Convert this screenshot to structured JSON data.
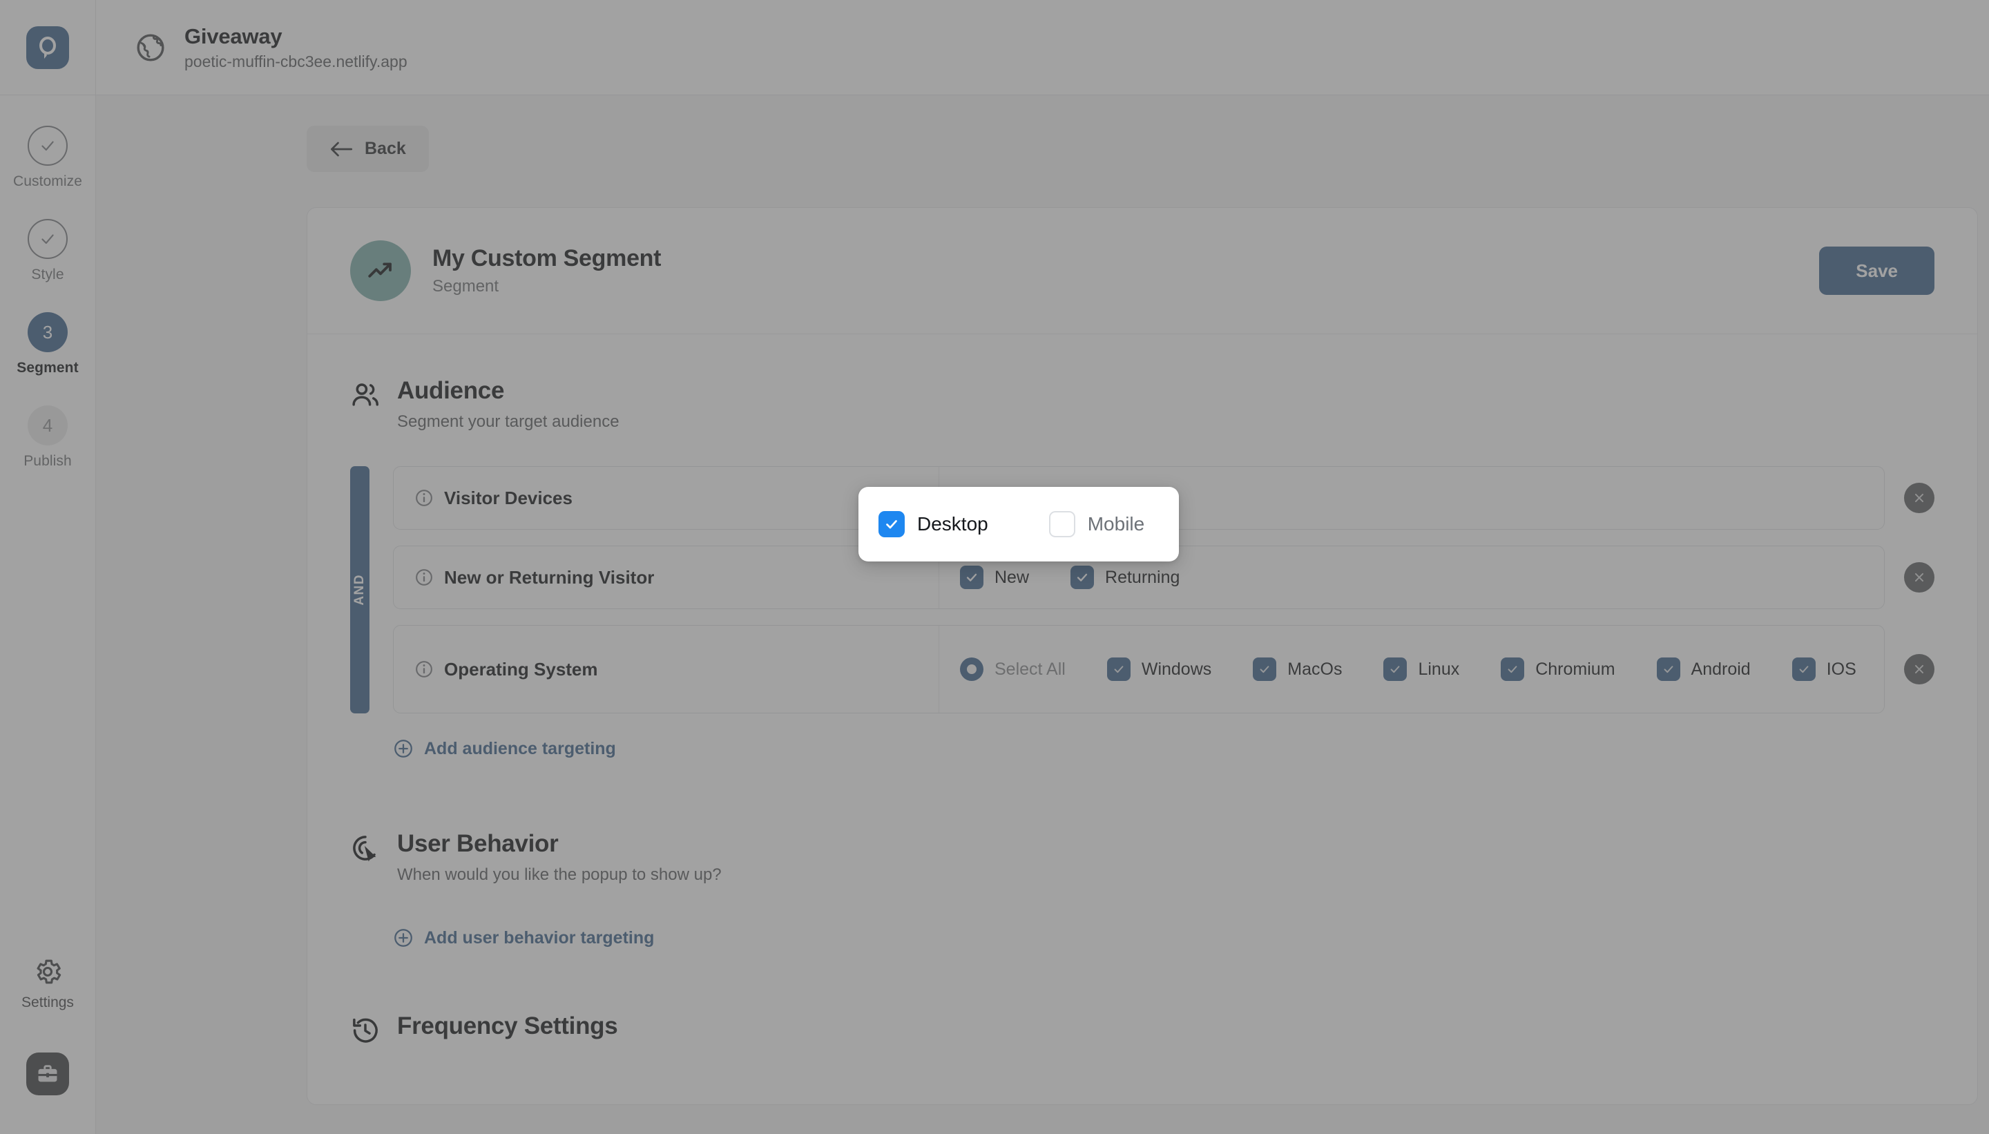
{
  "sidebar": {
    "logo_icon": "popupsmart-logo-icon",
    "steps": [
      {
        "id": "customize",
        "badge": "check",
        "label": "Customize",
        "state": "done"
      },
      {
        "id": "style",
        "badge": "check",
        "label": "Style",
        "state": "done"
      },
      {
        "id": "segment",
        "badge": "3",
        "label": "Segment",
        "state": "active"
      },
      {
        "id": "publish",
        "badge": "4",
        "label": "Publish",
        "state": "pending"
      }
    ],
    "settings_label": "Settings",
    "settings_icon": "gear-icon",
    "workspace_icon": "briefcase-icon"
  },
  "topbar": {
    "globe_icon": "globe-icon",
    "title": "Giveaway",
    "url": "poetic-muffin-cbc3ee.netlify.app"
  },
  "toolbar": {
    "back_label": "Back",
    "back_icon": "arrow-left-icon"
  },
  "segment_card": {
    "avatar_icon": "trending-up-icon",
    "avatar_color": "#4CBBAF",
    "name": "My Custom Segment",
    "subtitle": "Segment",
    "save_label": "Save",
    "save_color": "#1769C6"
  },
  "audience": {
    "icon": "people-icon",
    "title": "Audience",
    "subtitle": "Segment your target audience",
    "operator": "AND",
    "operator_color": "#1769C6",
    "rules": [
      {
        "id": "visitor-devices",
        "label": "Visitor Devices",
        "info_icon": "info-icon",
        "delete_icon": "close-icon",
        "options": []
      },
      {
        "id": "new-or-returning-visitor",
        "label": "New or Returning Visitor",
        "info_icon": "info-icon",
        "delete_icon": "close-icon",
        "options": [
          {
            "label": "New",
            "state": "checked"
          },
          {
            "label": "Returning",
            "state": "checked"
          }
        ]
      },
      {
        "id": "operating-system",
        "label": "Operating System",
        "info_icon": "info-icon",
        "delete_icon": "close-icon",
        "options": [
          {
            "label": "Select All",
            "state": "partial"
          },
          {
            "label": "Windows",
            "state": "checked"
          },
          {
            "label": "MacOs",
            "state": "checked"
          },
          {
            "label": "Linux",
            "state": "checked"
          },
          {
            "label": "Chromium",
            "state": "checked"
          },
          {
            "label": "Android",
            "state": "checked"
          },
          {
            "label": "IOS",
            "state": "checked"
          }
        ]
      }
    ],
    "add_label": "Add audience targeting",
    "add_icon": "plus-circle-icon"
  },
  "user_behavior": {
    "icon": "cursor-click-icon",
    "title": "User Behavior",
    "subtitle": "When would you like the popup to show up?",
    "add_label": "Add user behavior targeting",
    "add_icon": "plus-circle-icon"
  },
  "frequency": {
    "icon": "history-clock-icon",
    "title": "Frequency Settings"
  },
  "spotlight_popup": {
    "options": [
      {
        "label": "Desktop",
        "state": "checked"
      },
      {
        "label": "Mobile",
        "state": "unchecked"
      }
    ],
    "accent": "#1E87F0"
  }
}
